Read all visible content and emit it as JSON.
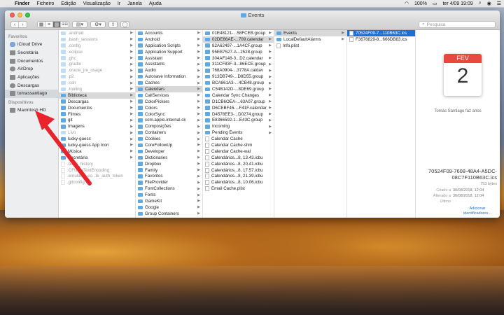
{
  "menubar": {
    "app": "Finder",
    "items": [
      "Ficheiro",
      "Edição",
      "Visualização",
      "Ir",
      "Janela",
      "Ajuda"
    ],
    "battery": "100%",
    "clock": "ter 4/09  19:09"
  },
  "window": {
    "title": "Events",
    "view_gallery_label": "⊞⊞",
    "search_placeholder": "Pesquisa"
  },
  "sidebar": {
    "favorites_heading": "Favoritos",
    "favorites": [
      "iCloud Drive",
      "Secretária",
      "Documentos",
      "AirDrop",
      "Aplicações",
      "Descargas",
      "tomassantiago"
    ],
    "devices_heading": "Dispositivos",
    "devices": [
      "Macintosh HD"
    ]
  },
  "columns": {
    "col1": [
      ".android",
      ".bash_sessions",
      ".config",
      ".eclipse",
      ".ghc",
      ".gradle",
      ".oracle_jre_usage",
      ".p2",
      ".ssh",
      ".tooling",
      "Biblioteca",
      "Descargas",
      "Documentos",
      "Filmes",
      "git",
      "Imagens",
      "Livo",
      "lucky-guess",
      "lucky-guess App Icon",
      "Música",
      "Secretária",
      ".bash_history",
      ".CFUserTextEncoding",
      ".emulator_co...le_auth_token",
      ".gitconfig"
    ],
    "col2": [
      "Accounts",
      "Android",
      "Application Scripts",
      "Application Support",
      "Assistant",
      "Assistants",
      "Audio",
      "Autosave Information",
      "Caches",
      "Calendars",
      "CallServices",
      "ColorPickers",
      "Colors",
      "ColorSync",
      "com.apple.internal.ck",
      "Composições",
      "Containers",
      "Cookies",
      "CoreFollowUp",
      "Developer",
      "Dictionaries",
      "Dropbox",
      "Family",
      "Favoritos",
      "FileProvider",
      "FontCollections",
      "Fonts",
      "GameKit",
      "Google",
      "Group Containers"
    ],
    "col3": [
      "01E48121-...58FCEB.group",
      "02DE66AE-...709.calendar",
      "82A62497-...1A4CF.group",
      "95EB7527-A...2528.group",
      "304AF148-3...D2.calendar",
      "311CF83F-3...86ECE.group",
      "768A0904-...3778A.caldav",
      "913DB749-...D8D55.group",
      "BCA861A3-...4CB48.group",
      "C54B142D-...8DE69.group",
      "Calendar Sync Changes",
      "D1CB6OEA-...63A07.group",
      "D6CEBF45-...F41F.calendar",
      "D4578EE3-...D0274.group",
      "E8366592-1...E43C.group",
      "Incoming",
      "Pending Events",
      "Calendar Cache",
      "Calendar Cache-shm",
      "Calendar Cache-wal",
      "Calendários...8, 13.43.icbu",
      "Calendários...8, 20.41.icbu",
      "Calendários...8, 17.57.icbu",
      "Calendários...8, 21.39.icbu",
      "Calendários...8, 10.06.icbu",
      "Email Cache.plist"
    ],
    "col4": [
      "Events",
      "LocalDefaultAlarms",
      "Info.plist"
    ],
    "col5": [
      "70524F09-7...110B63C.ics",
      "F3678829-8...666DB83.ics"
    ]
  },
  "preview": {
    "month": "FEV",
    "day": "2",
    "event_label": "Tomás Santiago faz anos",
    "filename": "70524F09-7608-48A4-A5DC-08C7F110B63C.ics",
    "size": "753 bytes",
    "created_label": "Criado a",
    "created": "30/08/2018, 12:04",
    "modified_label": "Alterado a",
    "modified": "30/08/2018, 12:04",
    "last_label": "Último",
    "last": "",
    "add_tags": "Adicionar",
    "add_tags2": "identificadores..."
  },
  "colors": {
    "selection": "#1c6fd9",
    "folder": "#5ea9e8",
    "annotation": "#e8232b"
  }
}
